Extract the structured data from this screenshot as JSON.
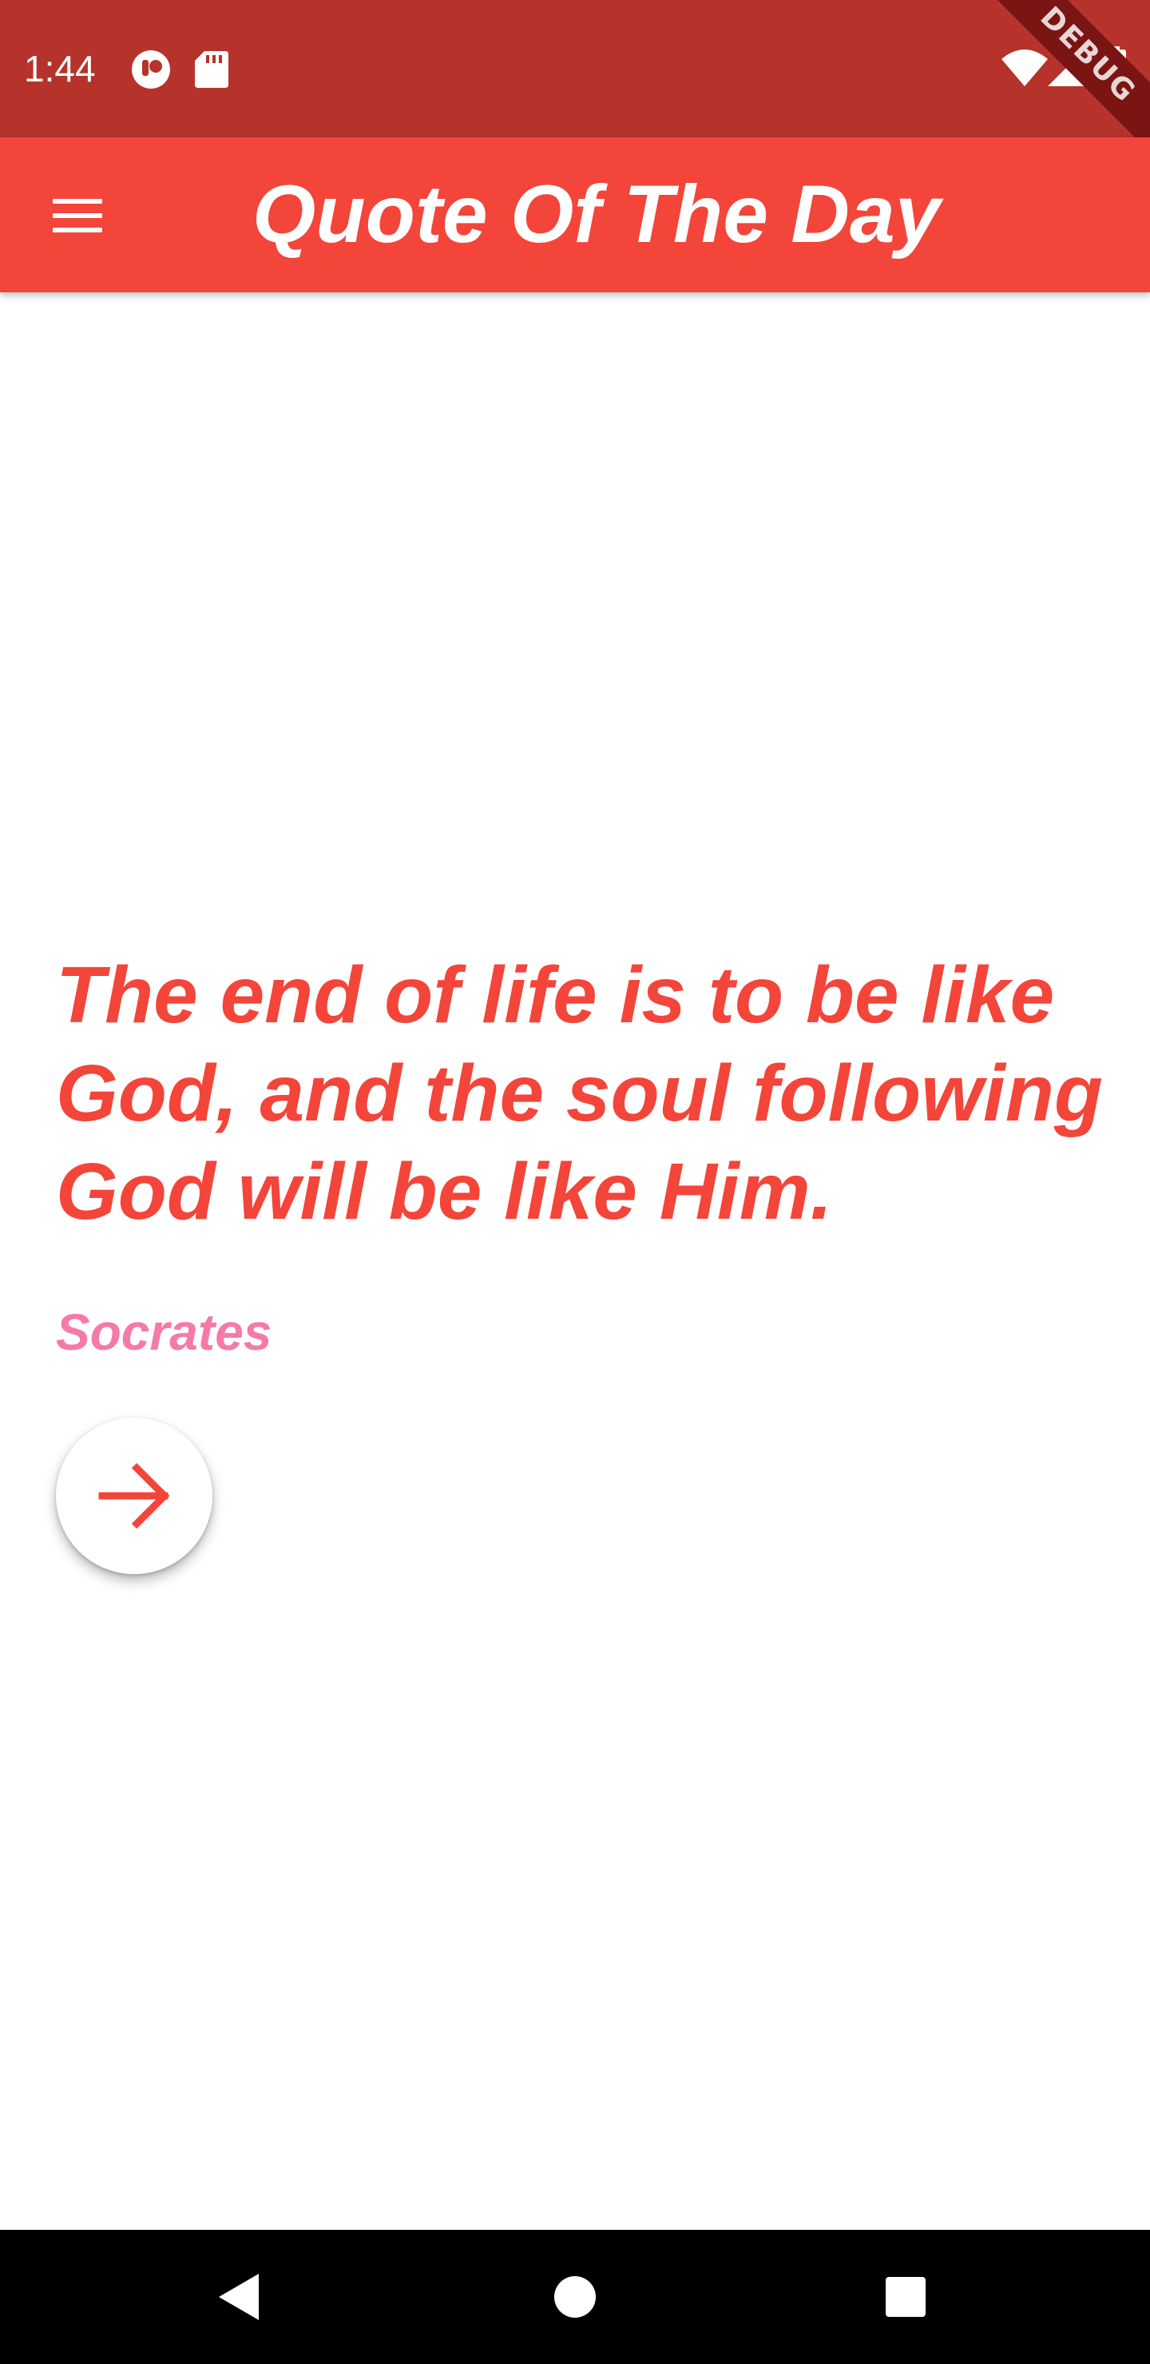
{
  "status_bar": {
    "time": "1:44",
    "background_color": "#b5332b",
    "icons": [
      "notification-app-icon",
      "sd-card-icon",
      "wifi-icon",
      "cell-signal-icon",
      "battery-icon"
    ],
    "debug_banner": "DEBUG"
  },
  "app_bar": {
    "title": "Quote Of The Day",
    "background_color": "#f3453a",
    "menu_icon": "hamburger-menu-icon"
  },
  "quote": {
    "text": "The end of life is to be like God, and the soul following God will be like Him.",
    "author": "Socrates",
    "text_color": "#f3453a",
    "author_color": "#f57aa7"
  },
  "next_button": {
    "icon": "arrow-right-icon"
  },
  "nav_bar": {
    "icons": [
      "back-icon",
      "home-icon",
      "recents-icon"
    ]
  }
}
